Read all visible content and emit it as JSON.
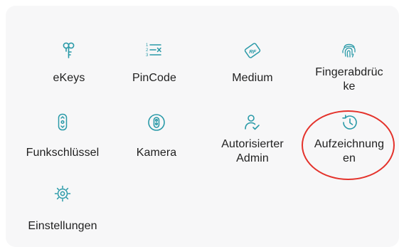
{
  "menu": {
    "items": [
      {
        "label": "eKeys",
        "icon": "ekeys-icon"
      },
      {
        "label": "PinCode",
        "icon": "pincode-icon"
      },
      {
        "label": "Medium",
        "icon": "rf-card-icon"
      },
      {
        "label": "Fingerabdrüc\nke",
        "icon": "fingerprint-icon"
      },
      {
        "label": "Funkschlüssel",
        "icon": "key-fob-icon"
      },
      {
        "label": "Kamera",
        "icon": "camera-icon"
      },
      {
        "label": "Autorisierter\nAdmin",
        "icon": "authorized-admin-icon"
      },
      {
        "label": "Aufzeichnung\nen",
        "icon": "history-icon"
      },
      {
        "label": "Einstellungen",
        "icon": "settings-gear-icon"
      }
    ]
  },
  "colors": {
    "icon": "#2a9aa8",
    "highlight_circle": "#e4322b",
    "panel_background": "#f7f7f8",
    "label_text": "#1f1f1f"
  }
}
